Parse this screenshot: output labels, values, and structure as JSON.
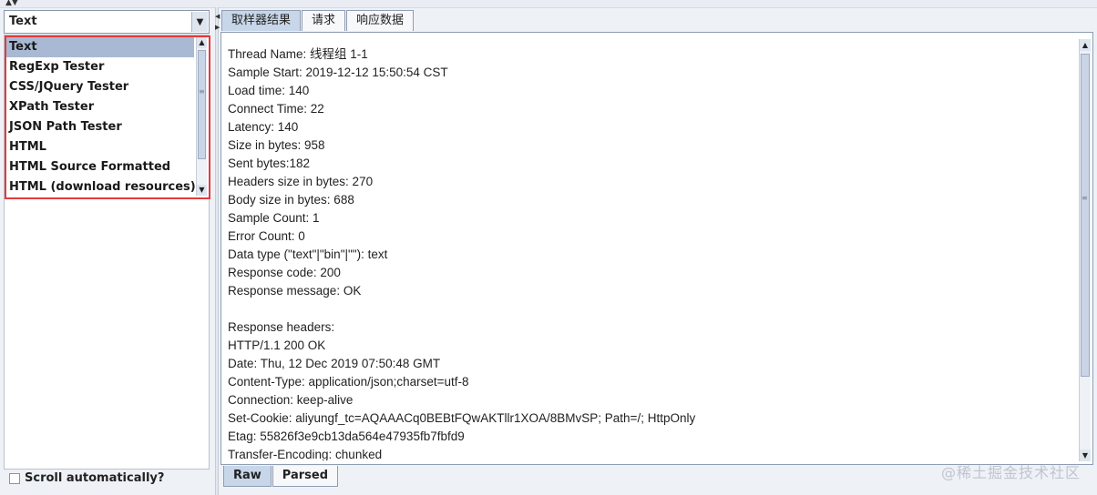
{
  "renderer": {
    "selected": "Text",
    "items": [
      "Text",
      "RegExp Tester",
      "CSS/JQuery Tester",
      "XPath Tester",
      "JSON Path Tester",
      "HTML",
      "HTML Source Formatted",
      "HTML (download resources)"
    ]
  },
  "scroll_auto": {
    "label": "Scroll automatically?"
  },
  "tabs": [
    "取样器结果",
    "请求",
    "响应数据"
  ],
  "result_lines": [
    "Thread Name: 线程组 1-1",
    "Sample Start: 2019-12-12 15:50:54 CST",
    "Load time: 140",
    "Connect Time: 22",
    "Latency: 140",
    "Size in bytes: 958",
    "Sent bytes:182",
    "Headers size in bytes: 270",
    "Body size in bytes: 688",
    "Sample Count: 1",
    "Error Count: 0",
    "Data type (\"text\"|\"bin\"|\"\"): text",
    "Response code: 200",
    "Response message: OK",
    "",
    "Response headers:",
    "HTTP/1.1 200 OK",
    "Date: Thu, 12 Dec 2019 07:50:48 GMT",
    "Content-Type: application/json;charset=utf-8",
    "Connection: keep-alive",
    "Set-Cookie: aliyungf_tc=AQAAACq0BEBtFQwAKTllr1XOA/8BMvSP; Path=/; HttpOnly",
    "Etag: 55826f3e9cb13da564e47935fb7fbfd9",
    "Transfer-Encoding: chunked"
  ],
  "bottom_tabs": [
    "Raw",
    "Parsed"
  ],
  "watermark": "@稀土掘金技术社区",
  "colors": {
    "highlight_box": "#e23b3b",
    "selection": "#a9b9d4",
    "active_tab": "#c8d6ea"
  }
}
